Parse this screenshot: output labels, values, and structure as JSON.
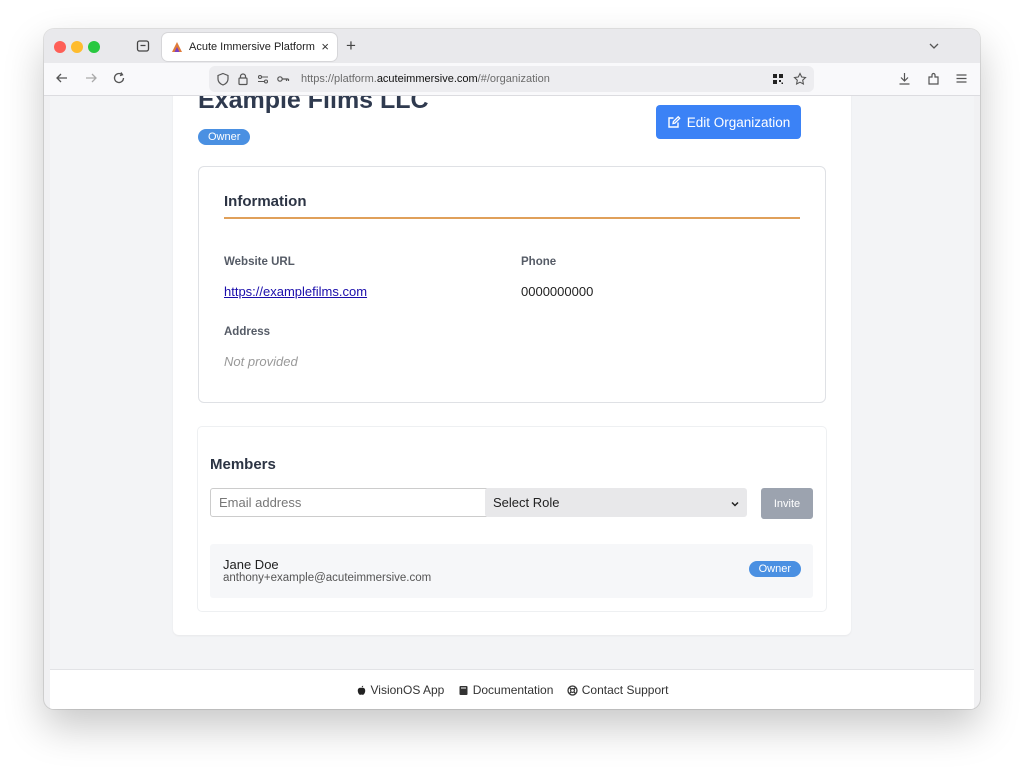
{
  "browser": {
    "tab_title": "Acute Immersive Platform",
    "tab_close": "×",
    "new_tab": "+",
    "url_prefix": "https://platform.",
    "url_host": "acuteimmersive.com",
    "url_path": "/#/organization"
  },
  "org": {
    "name": "Example Films LLC",
    "role_badge": "Owner",
    "edit_label": "Edit Organization"
  },
  "info": {
    "heading": "Information",
    "website_label": "Website URL",
    "website_value": "https://examplefilms.com",
    "phone_label": "Phone",
    "phone_value": "0000000000",
    "address_label": "Address",
    "address_value": "Not provided"
  },
  "members": {
    "heading": "Members",
    "email_placeholder": "Email address",
    "role_select": "Select Role",
    "invite_label": "Invite",
    "list": [
      {
        "name": "Jane Doe",
        "email": "anthony+example@acuteimmersive.com",
        "role": "Owner"
      }
    ]
  },
  "footer": {
    "visionos": "VisionOS App",
    "docs": "Documentation",
    "support": "Contact Support"
  },
  "colors": {
    "accent": "#3b82f6",
    "badge": "#4a90e2",
    "rule": "#e0a05a",
    "invite_disabled": "#9ca3af"
  }
}
